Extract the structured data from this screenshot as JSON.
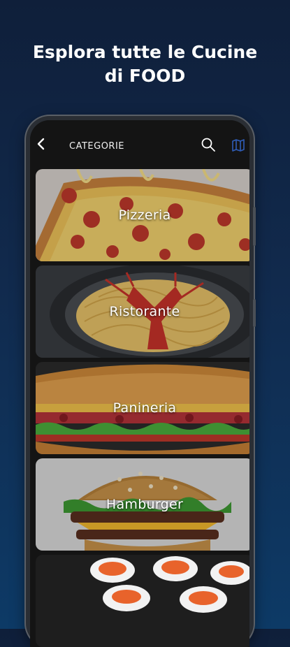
{
  "headline": {
    "line1": "Esplora tutte le Cucine",
    "line2": "di FOOD"
  },
  "appbar": {
    "title": "CATEGORIE",
    "back_icon": "back-arrow-icon",
    "search_icon": "search-icon",
    "map_icon": "map-icon"
  },
  "categories": [
    {
      "label": "Pizzeria"
    },
    {
      "label": "Ristorante"
    },
    {
      "label": "Panineria"
    },
    {
      "label": "Hamburger"
    },
    {
      "label": ""
    }
  ],
  "colors": {
    "background": "#112a4d",
    "accent": "#2f5db8"
  }
}
